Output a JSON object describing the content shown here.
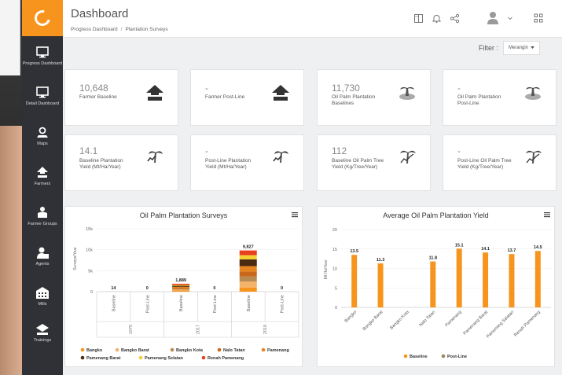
{
  "header": {
    "title": "Dashboard",
    "breadcrumb": [
      "Progress Dashboard",
      "Plantation Surveys"
    ]
  },
  "sidebar": {
    "items": [
      {
        "label": "Progress Dashboard",
        "icon": "monitor-icon"
      },
      {
        "label": "Detail Dashboard",
        "icon": "monitor-icon"
      },
      {
        "label": "Maps",
        "icon": "map-pin-icon"
      },
      {
        "label": "Farmers",
        "icon": "farmer-icon"
      },
      {
        "label": "Farmer Groups",
        "icon": "farmer-groups-icon"
      },
      {
        "label": "Agents",
        "icon": "agent-icon"
      },
      {
        "label": "Mills",
        "icon": "mill-icon"
      },
      {
        "label": "Trainings",
        "icon": "training-icon"
      }
    ]
  },
  "filter": {
    "label": "Filter :",
    "button": "Merangin"
  },
  "stats": [
    {
      "value": "10,648",
      "label": "Farmer Baseline"
    },
    {
      "value": "-",
      "label": "Farmer Post-Line"
    },
    {
      "value": "11,730",
      "label": "Oil Palm Plantation Baselines"
    },
    {
      "value": "-",
      "label": "Oil Palm Plantation Post-Line"
    },
    {
      "value": "14.1",
      "label": "Baseline Plantation Yield (Mt/Ha/Year)"
    },
    {
      "value": "-",
      "label": "Post-Line Plantation Yield (Mt/Ha/Year)"
    },
    {
      "value": "112",
      "label": "Baseline Oil Palm Tree Yield (Kg/Tree/Year)"
    },
    {
      "value": "-",
      "label": "Post-Line Oil Palm Tree Yield (Kg/Tree/Year)"
    }
  ],
  "colors": {
    "accent": "#f7941d",
    "sidebar": "#2f3136",
    "series": [
      "#f7941d",
      "#f4b26a",
      "#b88a52",
      "#c9681a",
      "#e8841f",
      "#4a2b12",
      "#f5cf2f",
      "#e8401f"
    ]
  },
  "chart_data": [
    {
      "type": "bar",
      "title": "Oil Palm Plantation Surveys",
      "ylabel": "Surveys/Year",
      "ylim": [
        0,
        15000
      ],
      "yticks": [
        "0",
        "5k",
        "10k",
        "15k"
      ],
      "x_groups": [
        "1970",
        "2017",
        "2018"
      ],
      "x_sub": [
        "Baseline",
        "Post-Line"
      ],
      "stacked": true,
      "totals": [
        "14",
        "0",
        "1,889",
        "0",
        "9,827",
        "0"
      ],
      "series": [
        {
          "name": "Bangko",
          "values": [
            14,
            0,
            300,
            0,
            1000,
            0
          ]
        },
        {
          "name": "Bangko Barat",
          "values": [
            0,
            0,
            200,
            0,
            1400,
            0
          ]
        },
        {
          "name": "Bangko Kota",
          "values": [
            0,
            0,
            150,
            0,
            1200,
            0
          ]
        },
        {
          "name": "Nalo Tatan",
          "values": [
            0,
            0,
            200,
            0,
            1200,
            0
          ]
        },
        {
          "name": "Pamenang",
          "values": [
            0,
            0,
            300,
            0,
            1300,
            0
          ]
        },
        {
          "name": "Pamenang Barat",
          "values": [
            0,
            0,
            250,
            0,
            1600,
            0
          ]
        },
        {
          "name": "Pamenang Selatan",
          "values": [
            0,
            0,
            200,
            0,
            1000,
            0
          ]
        },
        {
          "name": "Renah Pamenang",
          "values": [
            0,
            0,
            289,
            0,
            1127,
            0
          ]
        }
      ]
    },
    {
      "type": "bar",
      "title": "Average Oil Palm Plantation Yield",
      "ylabel": "Mt Ha/Year",
      "ylim": [
        0,
        20
      ],
      "yticks": [
        "0",
        "5",
        "10",
        "15",
        "20"
      ],
      "categories": [
        "Bangko",
        "Bangko Barat",
        "Bangko Kota",
        "Nalo Tatan",
        "Pamenang",
        "Pamenang Barat",
        "Pamenang Selatan",
        "Renah Pamenang"
      ],
      "series": [
        {
          "name": "Baseline",
          "values": [
            13.5,
            11.3,
            null,
            11.8,
            15.1,
            14.1,
            13.7,
            14.5
          ]
        },
        {
          "name": "Post-Line",
          "values": [
            null,
            null,
            null,
            null,
            null,
            null,
            null,
            null
          ]
        }
      ],
      "labels": [
        "13.5",
        "11.3",
        "",
        "11.8",
        "15.1",
        "14.1",
        "13.7",
        "14.5"
      ]
    }
  ]
}
